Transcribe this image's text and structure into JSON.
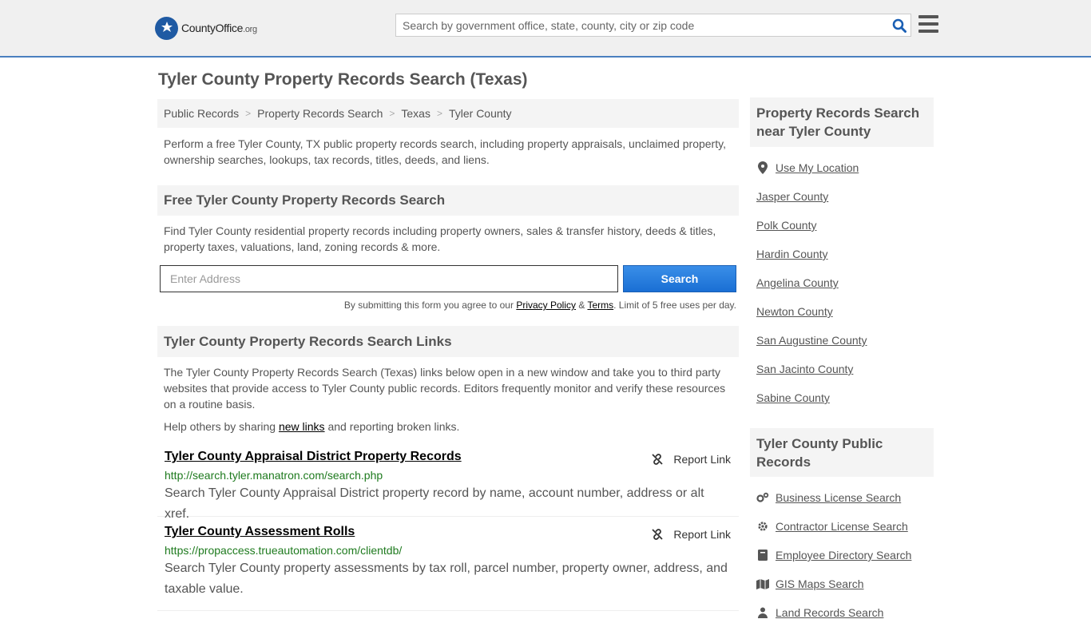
{
  "header": {
    "logo_county": "County",
    "logo_office": "Office",
    "logo_org": ".org",
    "search_placeholder": "Search by government office, state, county, city or zip code"
  },
  "page_title": "Tyler County Property Records Search (Texas)",
  "breadcrumb": [
    "Public Records",
    "Property Records Search",
    "Texas",
    "Tyler County"
  ],
  "intro": "Perform a free Tyler County, TX public property records search, including property appraisals, unclaimed property, ownership searches, lookups, tax records, titles, deeds, and liens.",
  "free_search": {
    "heading": "Free Tyler County Property Records Search",
    "text": "Find Tyler County residential property records including property owners, sales & transfer history, deeds & titles, property taxes, valuations, land, zoning records & more.",
    "address_placeholder": "Enter Address",
    "button_label": "Search",
    "disclaimer_pre": "By submitting this form you agree to our ",
    "privacy_label": "Privacy Policy",
    "amp": " & ",
    "terms_label": "Terms",
    "disclaimer_post": ". Limit of 5 free uses per day."
  },
  "links_section": {
    "heading": "Tyler County Property Records Search Links",
    "text": "The Tyler County Property Records Search (Texas) links below open in a new window and take you to third party websites that provide access to Tyler County public records. Editors frequently monitor and verify these resources on a routine basis.",
    "share_pre": "Help others by sharing ",
    "share_link": "new links",
    "share_post": " and reporting broken links.",
    "report_label": "Report Link",
    "results": [
      {
        "title": "Tyler County Appraisal District Property Records",
        "url": "http://search.tyler.manatron.com/search.php",
        "desc": "Search Tyler County Appraisal District property record by name, account number, address or alt xref."
      },
      {
        "title": "Tyler County Assessment Rolls",
        "url": "https://propaccess.trueautomation.com/clientdb/",
        "desc": "Search Tyler County property assessments by tax roll, parcel number, property owner, address, and taxable value."
      }
    ]
  },
  "sidebar": {
    "nearby_heading": "Property Records Search near Tyler County",
    "use_location": "Use My Location",
    "nearby": [
      "Jasper County",
      "Polk County",
      "Hardin County",
      "Angelina County",
      "Newton County",
      "San Augustine County",
      "San Jacinto County",
      "Sabine County"
    ],
    "public_heading": "Tyler County Public Records",
    "public_records": [
      {
        "label": "Business License Search",
        "icon": "gears-icon"
      },
      {
        "label": "Contractor License Search",
        "icon": "gear-icon"
      },
      {
        "label": "Employee Directory Search",
        "icon": "book-icon"
      },
      {
        "label": "GIS Maps Search",
        "icon": "map-icon"
      },
      {
        "label": "Land Records Search",
        "icon": "person-icon"
      }
    ]
  },
  "colors": {
    "accent_blue": "#1a6fd4",
    "url_green": "#1e7a1e",
    "header_border": "#4a7fbf"
  }
}
